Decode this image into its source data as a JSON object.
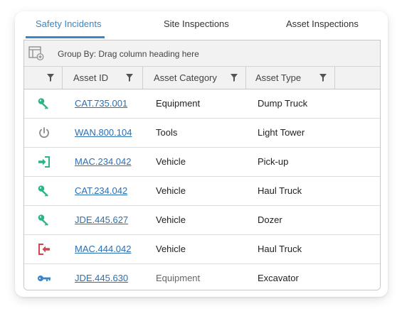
{
  "tabs": [
    {
      "label": "Safety Incidents",
      "active": true
    },
    {
      "label": "Site Inspections",
      "active": false
    },
    {
      "label": "Asset Inspections",
      "active": false
    }
  ],
  "grid": {
    "group_by_text": "Group By: Drag column heading here",
    "columns": [
      "",
      "Asset ID",
      "Asset Category",
      "Asset Type"
    ],
    "rows": [
      {
        "icon": "key-icon",
        "icon_color": "#2bb38a",
        "asset_id": "CAT.735.001",
        "category": "Equipment",
        "type": "Dump Truck"
      },
      {
        "icon": "power-icon",
        "icon_color": "#8a8a8a",
        "asset_id": "WAN.800.104",
        "category": "Tools",
        "type": "Light Tower"
      },
      {
        "icon": "sign-in-icon",
        "icon_color": "#2bb38a",
        "asset_id": "MAC.234.042",
        "category": "Vehicle",
        "type": "Pick-up"
      },
      {
        "icon": "key-icon",
        "icon_color": "#2bb38a",
        "asset_id": "CAT.234.042",
        "category": "Vehicle",
        "type": "Haul Truck"
      },
      {
        "icon": "key-icon",
        "icon_color": "#2bb38a",
        "asset_id": "JDE.445.627",
        "category": "Vehicle",
        "type": "Dozer"
      },
      {
        "icon": "sign-out-icon",
        "icon_color": "#d0484c",
        "asset_id": "MAC.444.042",
        "category": "Vehicle",
        "type": "Haul Truck"
      },
      {
        "icon": "key-horizontal-icon",
        "icon_color": "#3a86c8",
        "asset_id": "JDE.445.630",
        "category": "Equipment",
        "type": "Excavator"
      }
    ]
  },
  "colors": {
    "accent": "#3a86c8",
    "link": "#2a6fb3"
  }
}
